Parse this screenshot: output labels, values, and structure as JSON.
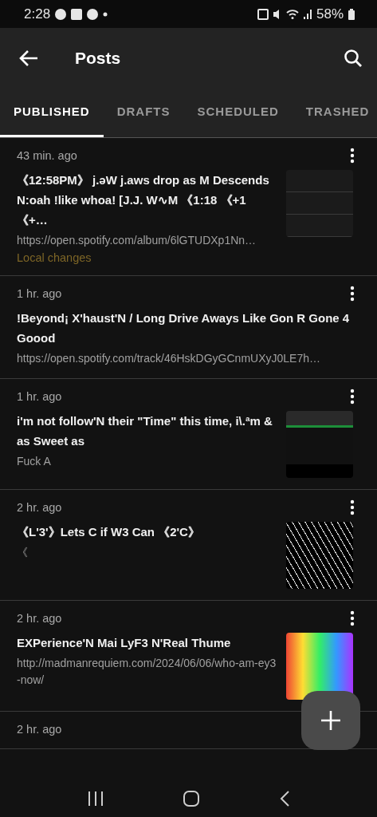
{
  "status_bar": {
    "time": "2:28",
    "battery": "58%"
  },
  "app_bar": {
    "title": "Posts"
  },
  "tabs": [
    {
      "label": "PUBLISHED",
      "selected": true
    },
    {
      "label": "DRAFTS",
      "selected": false
    },
    {
      "label": "SCHEDULED",
      "selected": false
    },
    {
      "label": "TRASHED",
      "selected": false
    }
  ],
  "posts": [
    {
      "time": "43 min. ago",
      "title": "《12:58PM》 j.əW j.aws drop as M Descends N:oah !like whoa! [J.J. W∿M 《1:18 《+1 《+…",
      "subtitle": "https://open.spotify.com/album/6lGTUDXp1Nn…",
      "note": "Local changes",
      "thumbnail": true
    },
    {
      "time": "1 hr. ago",
      "title": "!Beyond¡ X'haust'N / Long Drive Aways Like Gon R Gone 4 Goood",
      "subtitle": "https://open.spotify.com/track/46HskDGyGCnmUXyJ0LE7h…",
      "thumbnail": false
    },
    {
      "time": "1 hr. ago",
      "title": "i'm not follow'N their \"Time\" this time, i\\.ªm & as Sweet as",
      "subtitle": "Fuck A",
      "thumbnail": true
    },
    {
      "time": "2 hr. ago",
      "title": "《L'3'》Lets C if W3 Can 《2'C》",
      "subtitle": "《",
      "thumbnail": true
    },
    {
      "time": "2 hr. ago",
      "title": "EXPerience'N Mai LyF3 N'Real Thume",
      "subtitle": "http://madmanrequiem.com/2024/06/06/who-am-ey3-now/",
      "thumbnail": true
    },
    {
      "time": "2 hr. ago",
      "thumbnail": false
    }
  ]
}
